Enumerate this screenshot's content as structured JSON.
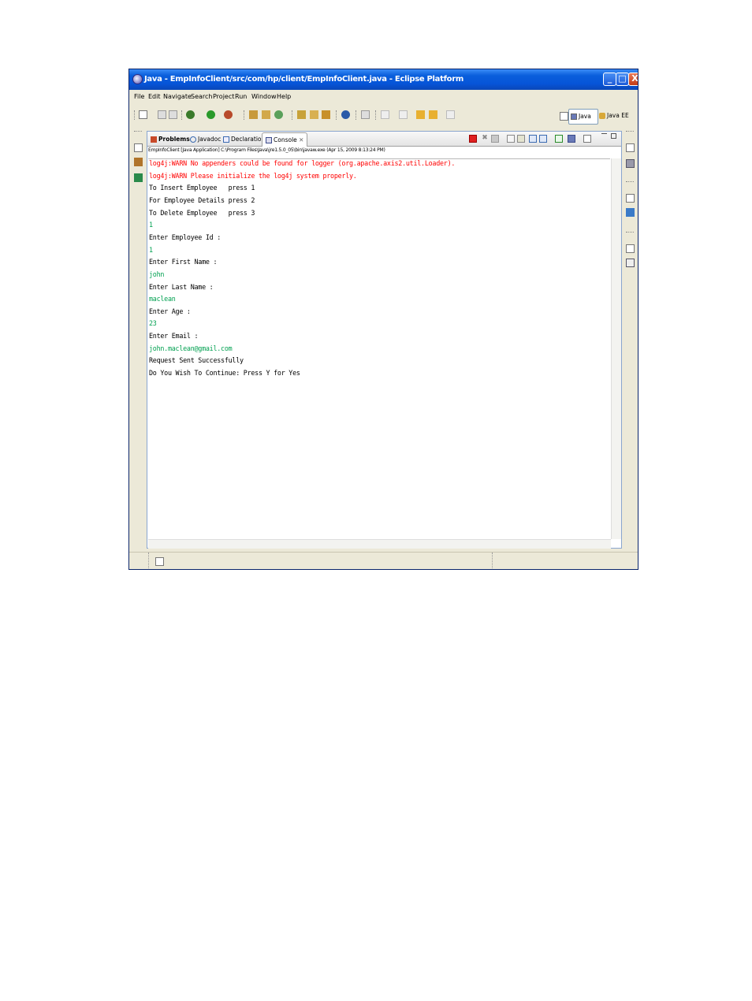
{
  "window": {
    "title": "Java - EmpInfoClient/src/com/hp/client/EmpInfoClient.java - Eclipse Platform",
    "controls": {
      "minimize": "_",
      "maximize": "□",
      "close": "X"
    }
  },
  "menubar": [
    "File",
    "Edit",
    "Navigate",
    "Search",
    "Project",
    "Run",
    "Window",
    "Help"
  ],
  "perspectives": {
    "java": "Java",
    "java_ee": "Java EE"
  },
  "view": {
    "tabs": [
      {
        "label": "Problems",
        "active": false
      },
      {
        "label": "Javadoc",
        "active": false
      },
      {
        "label": "Declaration",
        "active": false
      },
      {
        "label": "Console",
        "active": true,
        "close": "✕"
      }
    ],
    "launch_description": "EmpInfoClient [Java Application] C:\\Program Files\\Java\\jre1.5.0_05\\bin\\javaw.exe (Apr 15, 2009 8:13:24 PM)"
  },
  "console": {
    "lines": [
      {
        "text": "log4j:WARN No appenders could be found for logger (org.apache.axis2.util.Loader).",
        "kind": "err"
      },
      {
        "text": "log4j:WARN Please initialize the log4j system properly.",
        "kind": "err"
      },
      {
        "text": "To Insert Employee   press 1",
        "kind": "out"
      },
      {
        "text": "For Employee Details press 2",
        "kind": "out"
      },
      {
        "text": "To Delete Employee   press 3",
        "kind": "out"
      },
      {
        "text": "1",
        "kind": "inp"
      },
      {
        "text": "Enter Employee Id :",
        "kind": "out"
      },
      {
        "text": "1",
        "kind": "inp"
      },
      {
        "text": "Enter First Name :",
        "kind": "out"
      },
      {
        "text": "john",
        "kind": "inp"
      },
      {
        "text": "Enter Last Name :",
        "kind": "out"
      },
      {
        "text": "maclean",
        "kind": "inp"
      },
      {
        "text": "Enter Age :",
        "kind": "out"
      },
      {
        "text": "23",
        "kind": "inp"
      },
      {
        "text": "Enter Email :",
        "kind": "out"
      },
      {
        "text": "john.maclean@gmail.com",
        "kind": "inp"
      },
      {
        "text": "Request Sent Successfully",
        "kind": "out"
      },
      {
        "text": "Do You Wish To Continue: Press Y for Yes",
        "kind": "out"
      }
    ]
  },
  "colors": {
    "title_bar": "#0654d8",
    "error_text": "#ff0000",
    "input_text": "#00a050",
    "output_text": "#000000"
  },
  "icons": {
    "window": "eclipse-icon",
    "view_toolbar": [
      "terminate-icon",
      "remove-launch-icon",
      "remove-all-launches-icon",
      "clear-console-icon",
      "scroll-lock-icon",
      "show-on-stdout-icon",
      "show-on-stderr-icon",
      "pin-console-icon",
      "display-selected-console-icon",
      "open-console-icon",
      "minimize-view-icon",
      "maximize-view-icon"
    ]
  }
}
